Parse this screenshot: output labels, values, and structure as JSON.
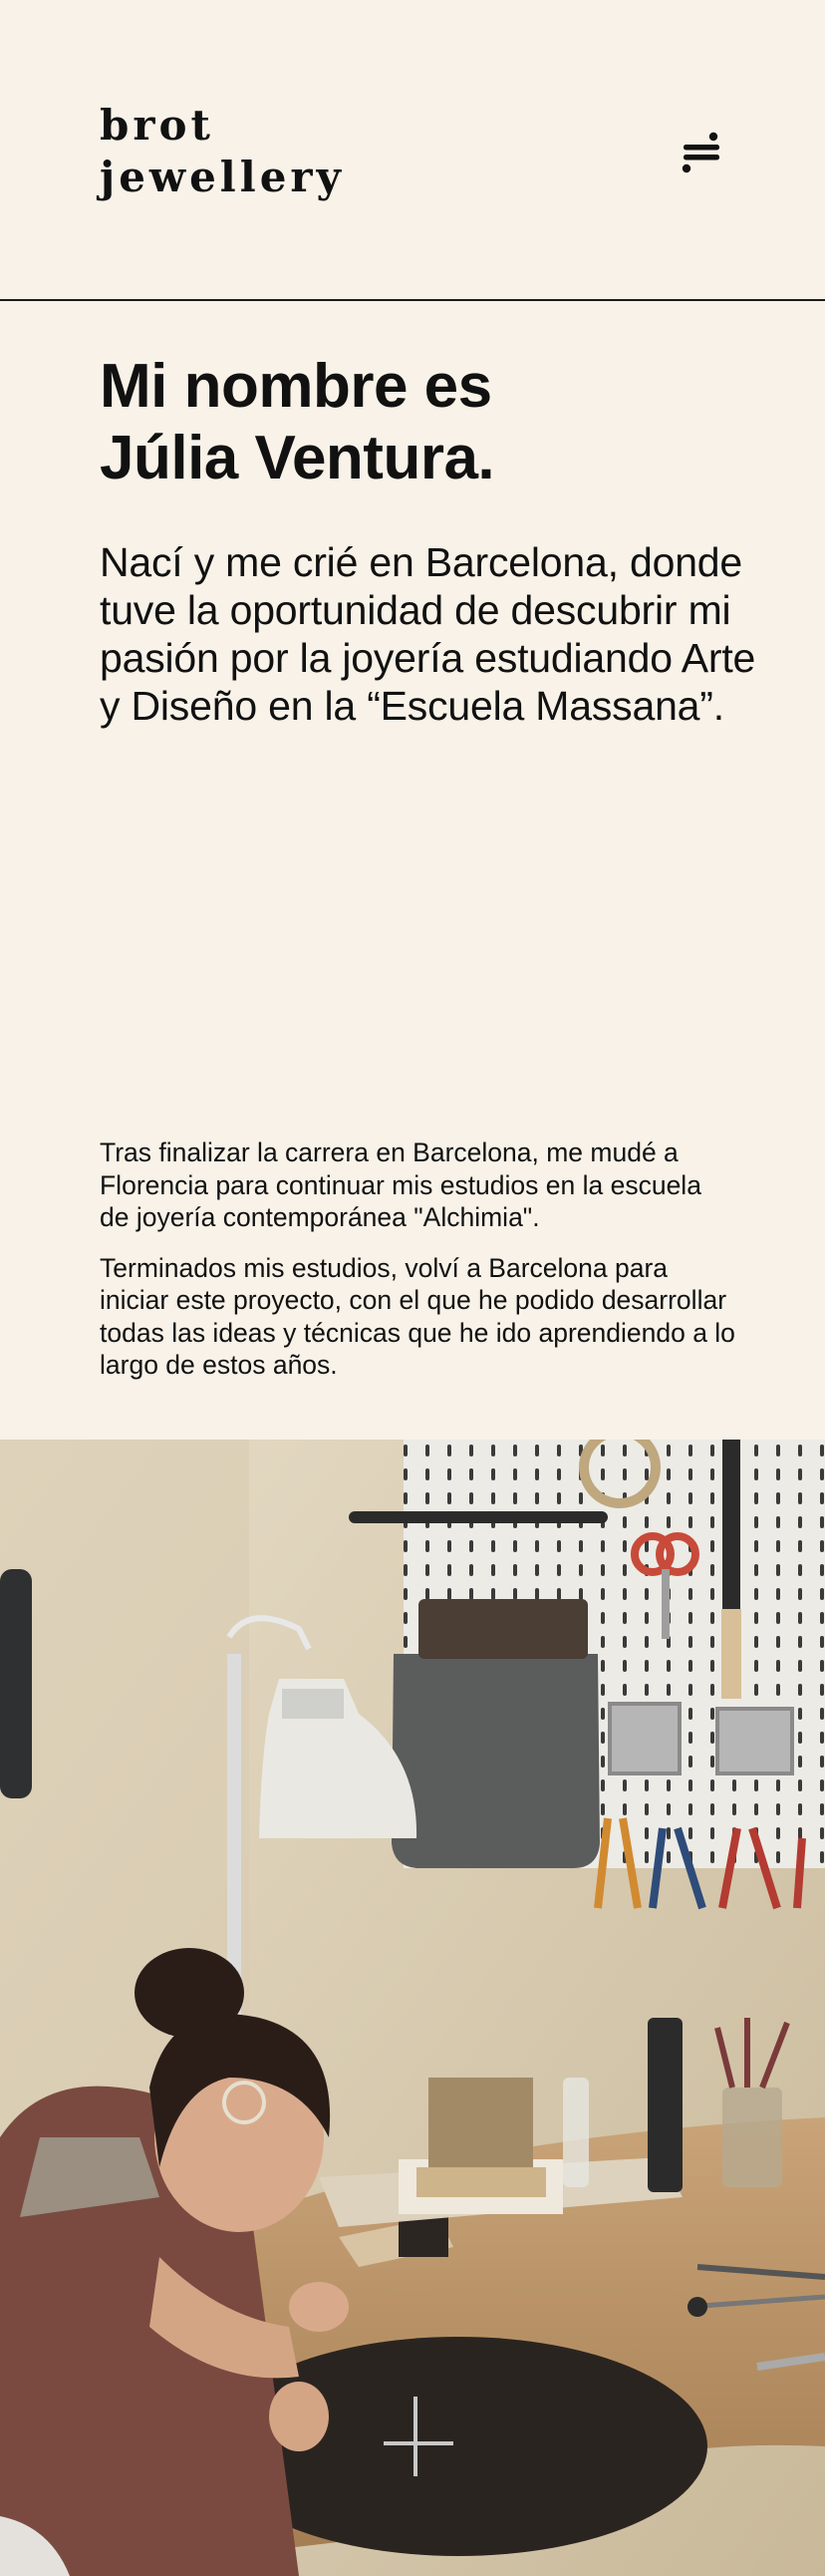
{
  "header": {
    "logo_line1": "brot",
    "logo_line2": "jewellery",
    "menu_icon": "menu-icon"
  },
  "hero": {
    "title_line1": "Mi nombre es",
    "title_line2": "Júlia Ventura.",
    "intro": "Nací y me crié en Barcelona, donde tuve la oportunidad de descubrir mi pasión por la joyería estudiando Arte y Diseño en la “Escuela Massana”."
  },
  "body": {
    "paragraph1": "Tras finalizar la carrera en Barcelona, me mudé a Florencia para continuar mis estudios en la escuela de joyería contemporánea \"Alchimia\".",
    "paragraph2": "Terminados mis estudios, volví a Barcelona para iniciar este proyecto, con el que he podido desarrollar todas las ideas y técnicas que he ido aprendiendo a lo largo de estos años."
  },
  "colors": {
    "background": "#f8f2e8",
    "text": "#111111",
    "divider": "#1a1a1a"
  }
}
